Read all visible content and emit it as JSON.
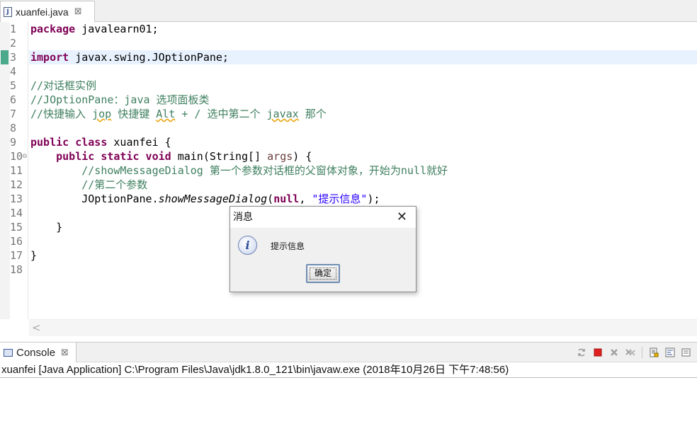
{
  "editor": {
    "tab_label": "xuanfei.java",
    "tab_icon": "J",
    "close_glyph": "⊠",
    "line_numbers": [
      "1",
      "2",
      "3",
      "4",
      "5",
      "6",
      "7",
      "8",
      "9",
      "10",
      "11",
      "12",
      "13",
      "14",
      "15",
      "16",
      "17",
      "18"
    ],
    "fold_glyph": "⊖",
    "code": {
      "l1_kw": "package",
      "l1_rest": " javalearn01;",
      "l3_kw": "import",
      "l3_rest": " javax.swing.JOptionPane;",
      "l5": "//对话框实例",
      "l6": "//JOptionPane：java 选项面板类",
      "l7_a": "//快捷输入 ",
      "l7_jop": "jop",
      "l7_b": " 快捷键 ",
      "l7_alt": "Alt",
      "l7_c": " + / 选中第二个 ",
      "l7_javax": "javax",
      "l7_d": " 那个",
      "l9_kw": "public class",
      "l9_rest": " xuanfei {",
      "l10_indent": "    ",
      "l10_kw": "public static void",
      "l10_mid": " main(String[] ",
      "l10_param": "args",
      "l10_end": ") {",
      "l11": "        //showMessageDialog 第一个参数对话框的父窗体对象，开始为null就好",
      "l12": "        //第二个参数",
      "l13_a": "        JOptionPane.",
      "l13_method": "showMessageDialog",
      "l13_b": "(",
      "l13_null": "null",
      "l13_c": ", ",
      "l13_str": "\"提示信息\"",
      "l13_d": ");",
      "l15": "    }",
      "l17": "}"
    },
    "scroll_left": "<"
  },
  "console": {
    "tab_label": "Console",
    "close_glyph": "⊠",
    "description": "xuanfei [Java Application] C:\\Program Files\\Java\\jdk1.8.0_121\\bin\\javaw.exe (2018年10月26日 下午7:48:56)",
    "toolbar_icons": [
      "sync-icon",
      "terminate-icon",
      "remove-launch-icon",
      "remove-all-icon",
      "scroll-lock-icon",
      "word-wrap-icon",
      "pin-icon"
    ]
  },
  "dialog": {
    "title": "消息",
    "close_glyph": "✕",
    "icon_glyph": "i",
    "message": "提示信息",
    "ok_label": "确定"
  }
}
